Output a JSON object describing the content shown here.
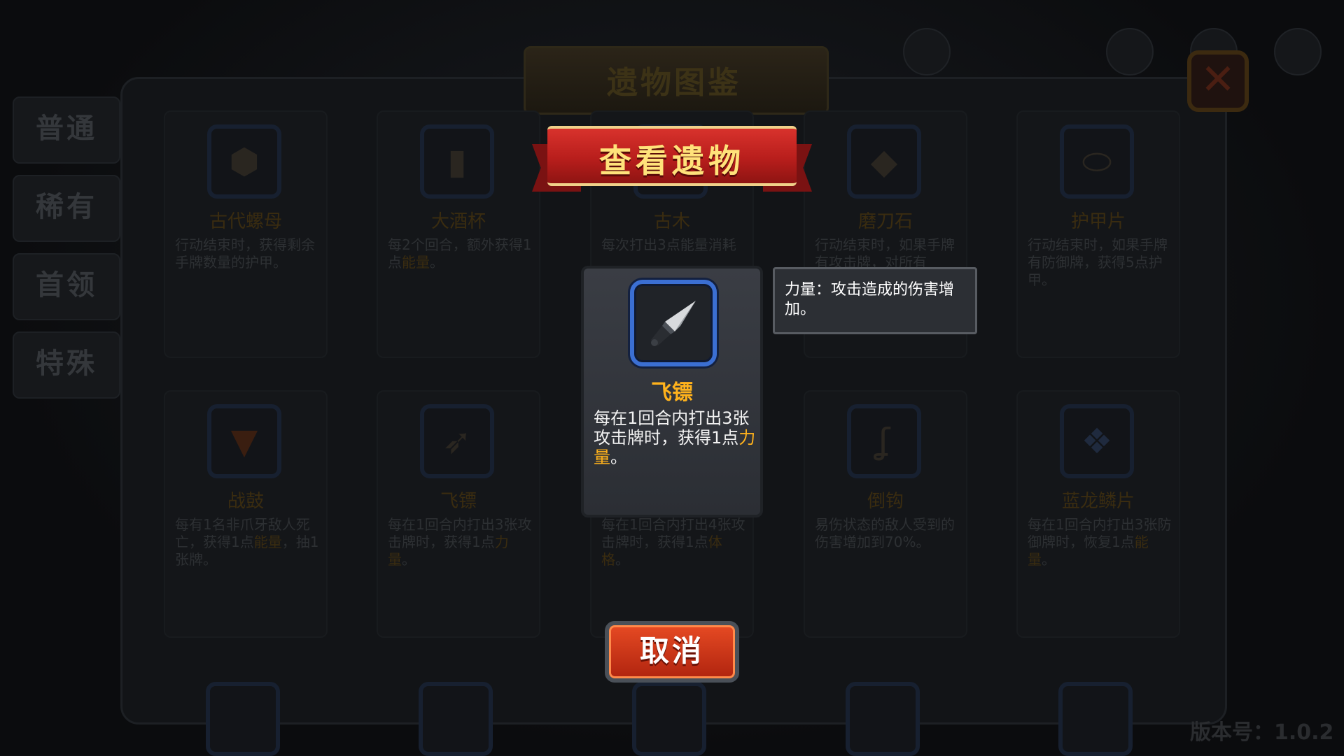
{
  "hud": {
    "left_text": "力量",
    "version": "版本号：1.0.2"
  },
  "book": {
    "title": "遗物图鉴",
    "close_label": "✕",
    "tabs": [
      "普通",
      "稀有",
      "首领",
      "特殊"
    ],
    "row1": [
      {
        "name": "古代螺母",
        "desc": "行动结束时，获得剩余手牌数量的护甲。",
        "icon": "nut-icon"
      },
      {
        "name": "大酒杯",
        "desc_pre": "每2个回合，额外获得1点",
        "desc_hl": "能量",
        "desc_post": "。",
        "icon": "mug-icon"
      },
      {
        "name": "古木",
        "desc": "每次打出3点能量消耗",
        "icon": "wood-icon"
      },
      {
        "name": "磨刀石",
        "desc": "行动结束时，如果手牌有攻击牌，对所有",
        "icon": "whetstone-icon"
      },
      {
        "name": "护甲片",
        "desc": "行动结束时，如果手牌有防御牌，获得5点护甲。",
        "icon": "armor-plate-icon"
      }
    ],
    "row2": [
      {
        "name": "战鼓",
        "desc_pre": "每有1名非爪牙敌人死亡，获得1点",
        "desc_hl": "能量",
        "desc_post": "，抽1张牌。",
        "icon": "war-drum-icon"
      },
      {
        "name": "飞镖",
        "desc_pre": "每在1回合内打出3张攻击牌时，获得1点",
        "desc_hl": "力量",
        "desc_post": "。",
        "icon": "dart-icon"
      },
      {
        "name": "",
        "desc_pre": "每在1回合内打出4张攻击牌时，获得1点",
        "desc_hl": "体格",
        "desc_post": "。",
        "icon": "unknown-icon"
      },
      {
        "name": "倒钩",
        "desc": "易伤状态的敌人受到的伤害增加到70%。",
        "icon": "barb-icon"
      },
      {
        "name": "蓝龙鳞片",
        "desc_pre": "每在1回合内打出3张防御牌时，恢复1点",
        "desc_hl": "能量",
        "desc_post": "。",
        "icon": "dragon-scale-icon"
      }
    ]
  },
  "modal": {
    "title": "查看遗物",
    "relic_name": "飞镖",
    "desc_pre": "每在1回合内打出3张攻击牌时，获得1点",
    "desc_hl": "力量",
    "desc_post": "。",
    "tooltip": "力量：攻击造成的伤害增加。",
    "cancel_label": "取消",
    "icon": "dart-icon"
  },
  "colors": {
    "highlight": "#ffb21c",
    "ribbon_red": "#c1221f",
    "frame_blue": "#3b6fd3",
    "cancel_orange": "#e64a23"
  }
}
